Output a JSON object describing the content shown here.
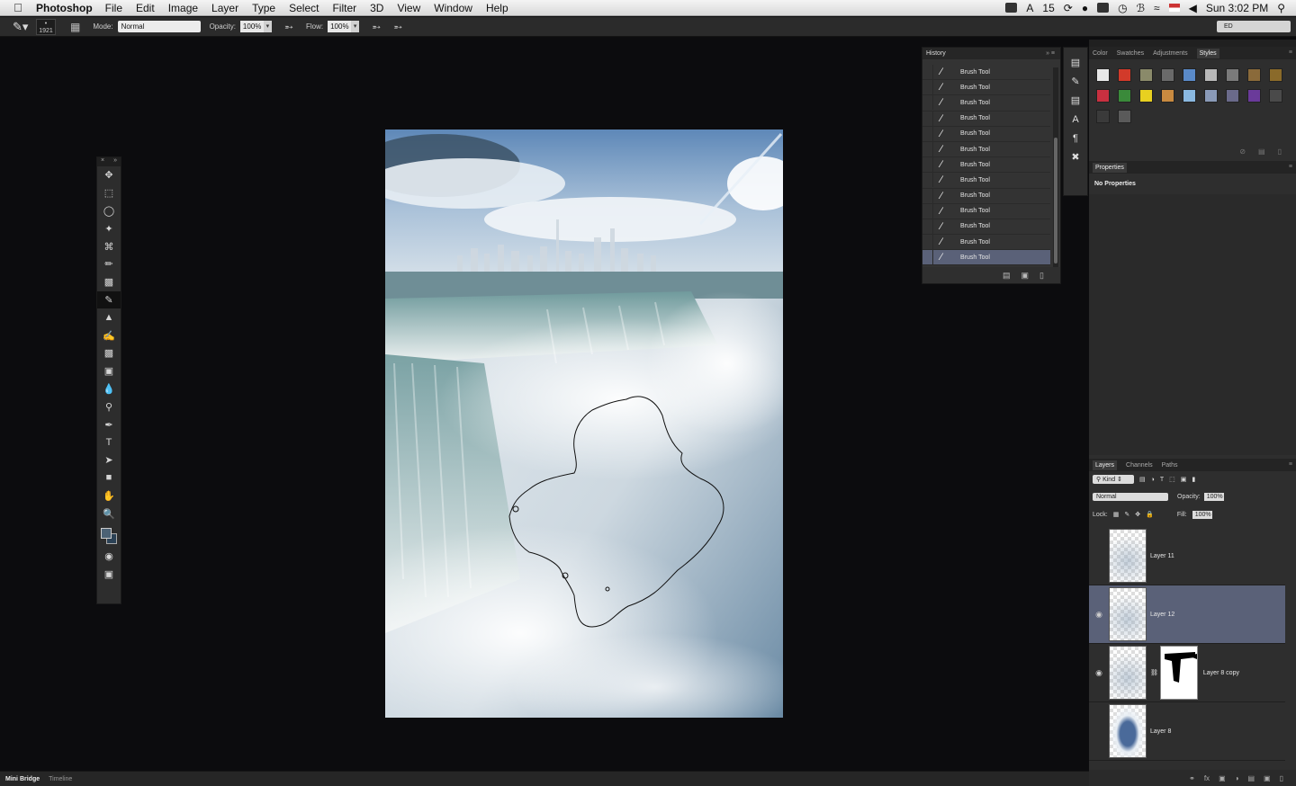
{
  "menubar": {
    "app": "Photoshop",
    "items": [
      "File",
      "Edit",
      "Image",
      "Layer",
      "Type",
      "Select",
      "Filter",
      "3D",
      "View",
      "Window",
      "Help"
    ],
    "status_num": "15",
    "clock": "Sun 3:02 PM"
  },
  "options": {
    "brush_size": "1921",
    "mode_label": "Mode:",
    "mode_value": "Normal",
    "opacity_label": "Opacity:",
    "opacity_value": "100%",
    "flow_label": "Flow:",
    "flow_value": "100%",
    "workspace": "ED"
  },
  "tools": [
    "move",
    "marquee",
    "lasso",
    "magic-wand",
    "crop",
    "eyedropper",
    "healing",
    "brush",
    "stamp",
    "history-brush",
    "eraser",
    "gradient",
    "blur",
    "dodge",
    "pen",
    "type",
    "path-select",
    "shape",
    "hand",
    "zoom"
  ],
  "history": {
    "title": "History",
    "items": [
      "Brush Tool",
      "Brush Tool",
      "Brush Tool",
      "Brush Tool",
      "Brush Tool",
      "Brush Tool",
      "Brush Tool",
      "Brush Tool",
      "Brush Tool",
      "Brush Tool",
      "Brush Tool",
      "Brush Tool",
      "Brush Tool"
    ],
    "selected_index": 12
  },
  "styles_panel": {
    "tabs": [
      "Color",
      "Swatches",
      "Adjustments",
      "Styles"
    ],
    "active": "Styles",
    "swatches": [
      "#e8e8e8",
      "#d23a2a",
      "#8a8a6a",
      "#6a6a6a",
      "#5a8ac8",
      "#b8b8b8",
      "#7a7a7a",
      "#8a6a3a",
      "#8a6a2a",
      "#c83040",
      "#3a8a3a",
      "#e8d020",
      "#c88a40",
      "#8ab8e0",
      "#8a9ab8",
      "#6a6a8a",
      "#6a3a9a",
      "#4a4a4a",
      "#3a3a3a",
      "#5a5a5a"
    ]
  },
  "properties": {
    "title": "Properties",
    "body": "No Properties"
  },
  "layers_panel": {
    "tabs": [
      "Layers",
      "Channels",
      "Paths"
    ],
    "kind": "Kind",
    "blend": "Normal",
    "opacity_label": "Opacity:",
    "opacity": "100%",
    "lock_label": "Lock:",
    "fill_label": "Fill:",
    "fill": "100%",
    "layers": [
      {
        "name": "Layer 11",
        "visible": false,
        "selected": false
      },
      {
        "name": "Layer 12",
        "visible": true,
        "selected": true
      },
      {
        "name": "Layer 8 copy",
        "visible": true,
        "selected": false
      },
      {
        "name": "Layer 8",
        "visible": false,
        "selected": false
      }
    ]
  },
  "bottom_tabs": [
    "Mini Bridge",
    "Timeline"
  ]
}
